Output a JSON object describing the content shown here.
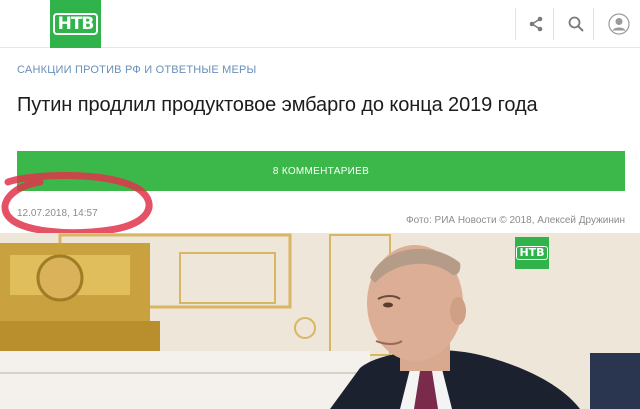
{
  "header": {
    "logo_text": "НТВ",
    "icons": [
      "share-icon",
      "search-icon",
      "user-icon"
    ]
  },
  "article": {
    "category": "САНКЦИИ ПРОТИВ РФ И ОТВЕТНЫЕ МЕРЫ",
    "title": "Путин продлил продуктовое эмбарго до конца 2019 года",
    "comments_label": "8 КОММЕНТАРИЕВ",
    "datetime": "12.07.2018, 14:57",
    "photo_credit": "Фото: РИА Новости © 2018, Алексей Дружинин"
  },
  "photo": {
    "watermark_text": "НТВ"
  },
  "colors": {
    "brand_green": "#2fb34a",
    "button_green": "#3cb84a",
    "category_blue": "#6a8fb8",
    "annotation_red": "#e0324a"
  }
}
